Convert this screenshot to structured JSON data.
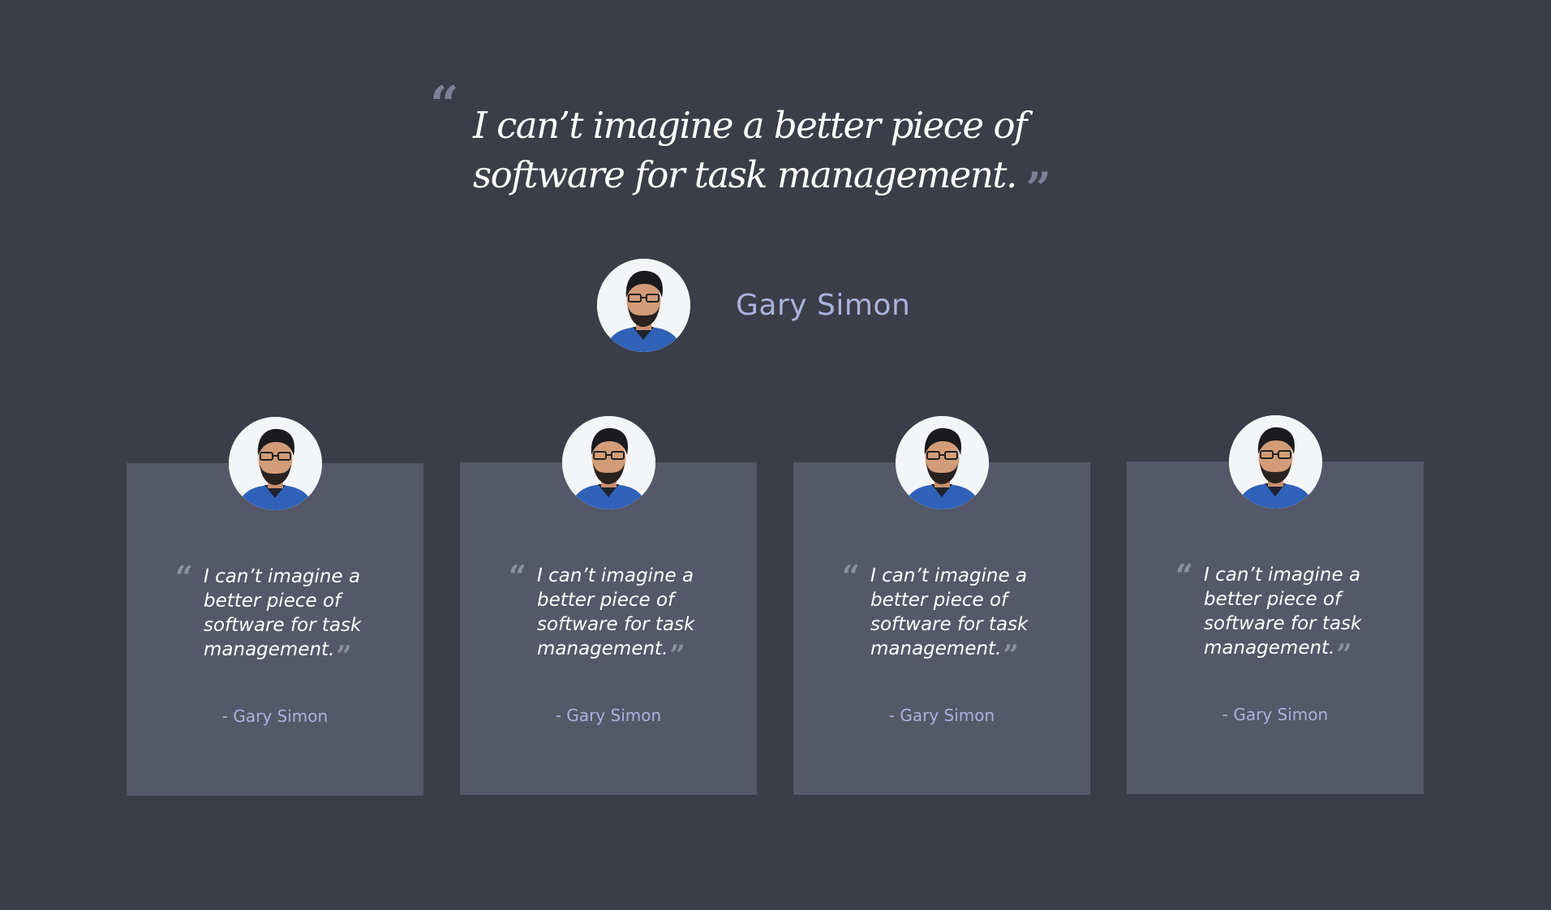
{
  "hero": {
    "open_mark": "“",
    "quote": "I can’t imagine a better piece of software for task management.",
    "close_mark": "”",
    "author": "Gary Simon",
    "avatar_icon": "portrait-photo"
  },
  "cards": [
    {
      "open_mark": "“",
      "quote": "I can’t imagine a better piece of software for task management.",
      "close_mark": "”",
      "author": "- Gary Simon"
    },
    {
      "open_mark": "“",
      "quote": "I can’t imagine a better piece of software for task management.",
      "close_mark": "”",
      "author": "- Gary Simon"
    },
    {
      "open_mark": "“",
      "quote": "I can’t imagine a better piece of software for task management.",
      "close_mark": "”",
      "author": "- Gary Simon"
    },
    {
      "open_mark": "“",
      "quote": "I can’t imagine a better piece of software for task management.",
      "close_mark": "”",
      "author": "- Gary Simon"
    }
  ],
  "colors": {
    "background": "#3b3d48",
    "card_background": "#545868",
    "quote_text": "#ffffff",
    "quote_mark": "#7d8196",
    "author_name": "#a9b2dc"
  }
}
